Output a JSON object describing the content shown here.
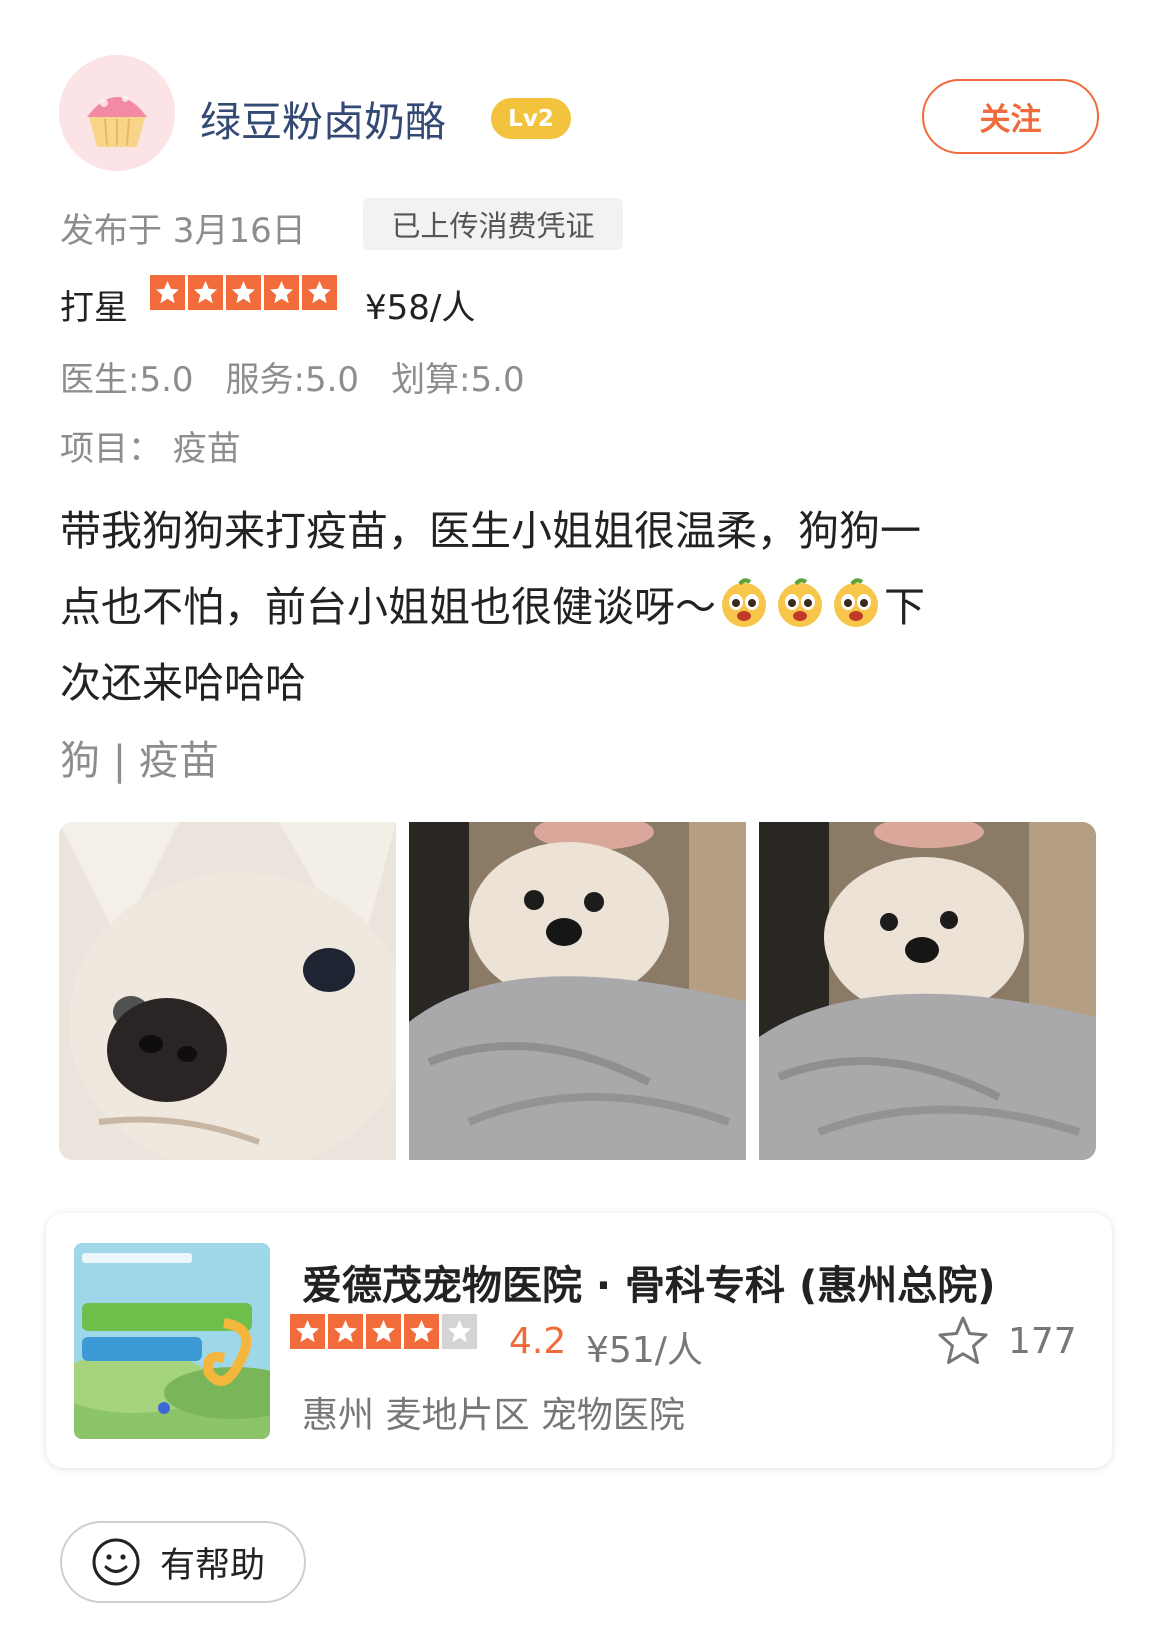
{
  "author": {
    "name": "绿豆粉卤奶酪",
    "level": "Lv2",
    "follow_label": "关注",
    "avatar_icon": "cupcake-avatar"
  },
  "meta": {
    "posted": "发布于 3月16日",
    "voucher_badge": "已上传消费凭证"
  },
  "rating": {
    "label": "打星",
    "stars": 5,
    "max_stars": 5,
    "price": "¥58/人",
    "subscores": [
      "医生:5.0",
      "服务:5.0",
      "划算:5.0"
    ],
    "project": "项目：  疫苗"
  },
  "review": {
    "lines": [
      "带我狗狗来打疫苗，医生小姐姐很温柔，狗狗一",
      "点也不怕，前台小姐姐也很健谈呀～",
      "次还来哈哈哈"
    ],
    "line2_tail": "下",
    "emoji_icon": "excited-face-emoji",
    "emoji_count": 3,
    "tags": "狗 | 疫苗"
  },
  "photos": [
    {
      "icon": "dog-closeup-photo"
    },
    {
      "icon": "dog-on-lap-photo"
    },
    {
      "icon": "dog-on-lap-photo"
    }
  ],
  "shop": {
    "name": "爱德茂宠物医院 · 骨科专科 (惠州总院)",
    "stars": 4,
    "max_stars": 5,
    "score": "4.2",
    "price": "¥51/人",
    "favorites": "177",
    "location": "惠州 麦地片区 宠物医院",
    "thumb_icon": "spring-promo-poster"
  },
  "helpful": {
    "label": "有帮助",
    "icon": "smile-icon"
  },
  "colors": {
    "accent": "#f06a3b",
    "star": "#f26b3a",
    "level_badge": "#f3c33d",
    "username": "#344a74",
    "muted": "#8d8d8d"
  }
}
